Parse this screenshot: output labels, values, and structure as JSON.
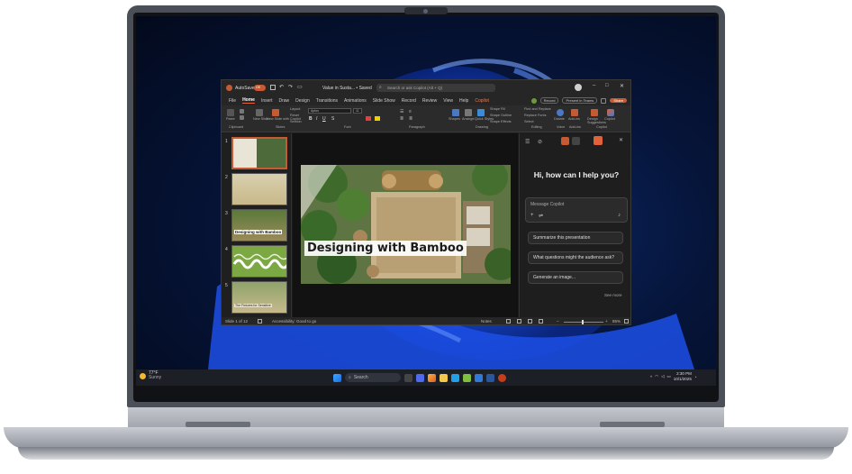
{
  "titlebar": {
    "autosave_label": "AutoSave",
    "autosave_state": "Off",
    "doc_title": "Value in Susta... • Saved",
    "search_placeholder": "Search or ask Copilot (Alt + Q)"
  },
  "menu": {
    "tabs": [
      "File",
      "Home",
      "Insert",
      "Draw",
      "Design",
      "Transitions",
      "Animations",
      "Slide Show",
      "Record",
      "Review",
      "View",
      "Help",
      "Copilot"
    ],
    "active_tab": "Home",
    "record_button": "Record",
    "present_button": "Present in Teams",
    "share_button": "Share"
  },
  "ribbon": {
    "groups": [
      "Clipboard",
      "Slides",
      "Font",
      "Paragraph",
      "Drawing",
      "Editing",
      "Voice",
      "Add-ins",
      "Copilot"
    ],
    "paste_label": "Paste",
    "new_slide_label": "New Slide",
    "new_slide_copilot_label": "New Slide with Copilot",
    "layout_label": "Layout",
    "reset_label": "Reset",
    "section_label": "Section",
    "shapes_label": "Shapes",
    "arrange_label": "Arrange",
    "quick_styles_label": "Quick Styles",
    "shape_fill_label": "Shape Fill",
    "shape_outline_label": "Shape Outline",
    "shape_effects_label": "Shape Effects",
    "find_replace_label": "Find and Replace",
    "replace_fonts_label": "Replace Fonts",
    "select_label": "Select",
    "dictate_label": "Dictate",
    "addins_label": "Add-ins",
    "design_suggestions_label": "Design Suggestions",
    "copilot_label": "Copilot",
    "font_name": "Aptos",
    "font_size": "11"
  },
  "thumbnails": {
    "numbers": [
      "1",
      "2",
      "3",
      "4",
      "5"
    ],
    "captions": [
      "",
      "",
      "Designing with Bamboo",
      "",
      "The Fixtures for Sensitive"
    ]
  },
  "slide": {
    "title": "Designing with Bamboo"
  },
  "copilot": {
    "greeting": "Hi, how can I help you?",
    "input_placeholder": "Message Copilot",
    "suggestions": [
      "Summarize this presentation",
      "What questions might the audience ask?",
      "Generate an image..."
    ],
    "see_more": "See more"
  },
  "statusbar": {
    "slide_count": "Slide 1 of 12",
    "accessibility": "Accessibility: Good to go",
    "notes": "Notes",
    "zoom": "85%"
  },
  "taskbar": {
    "weather_temp": "77°F",
    "weather_desc": "Sunny",
    "search_label": "Search",
    "time": "2:30 PM",
    "date": "10/1/2025"
  },
  "colors": {
    "accent": "#c65a33",
    "wallpaper": "#0b2a6b",
    "bloom": "#1e5bff"
  }
}
